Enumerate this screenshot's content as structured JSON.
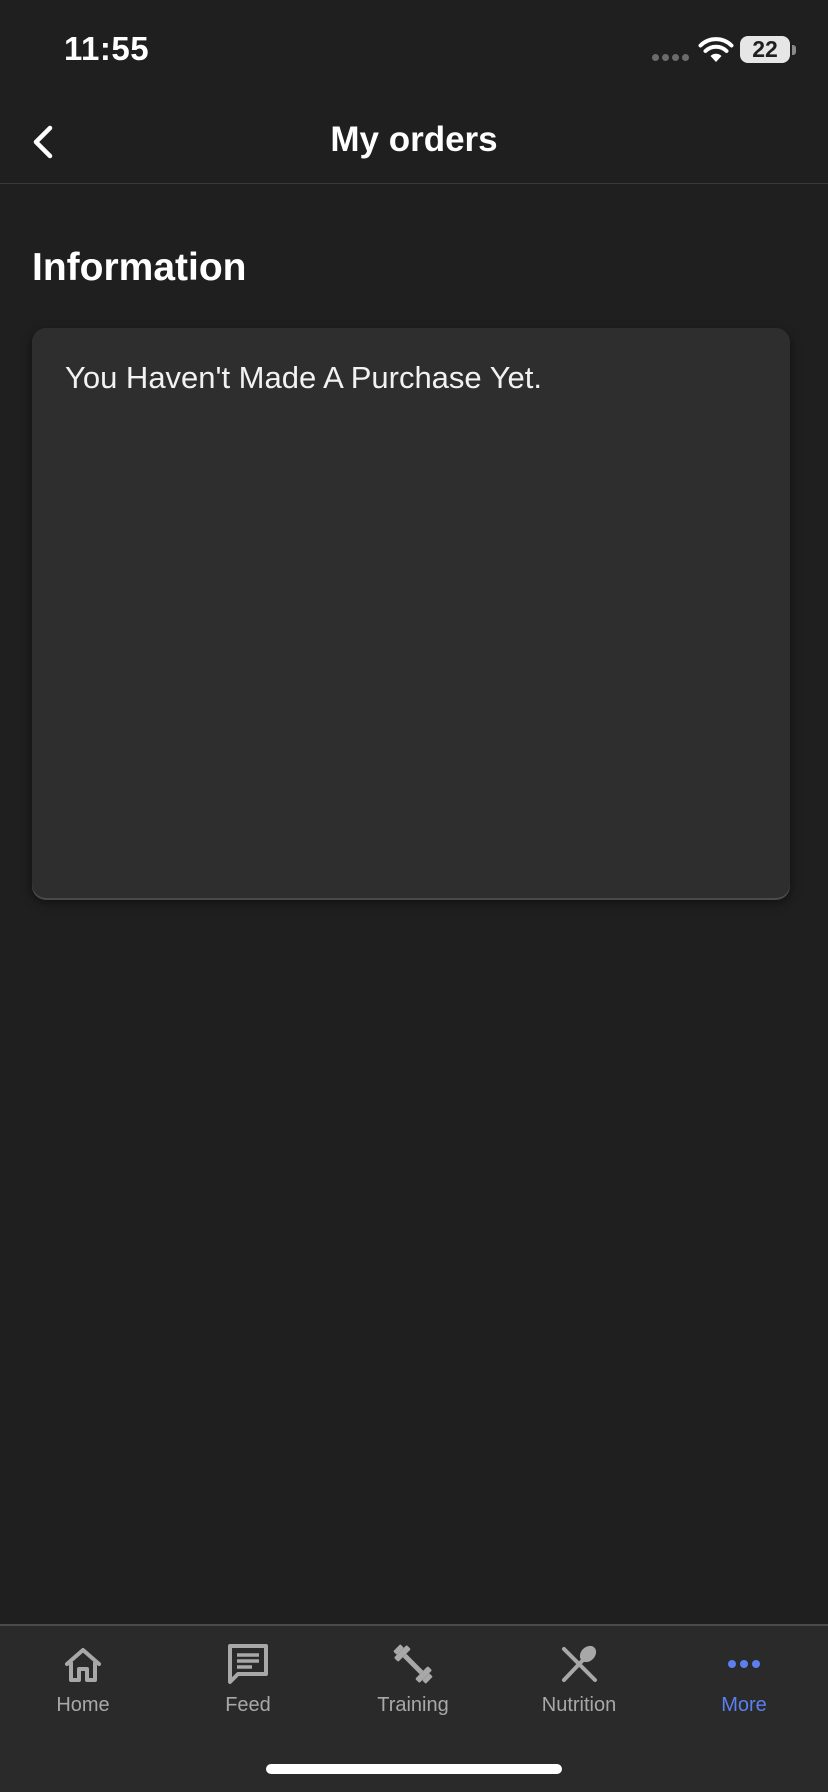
{
  "status_bar": {
    "time": "11:55",
    "battery": "22"
  },
  "nav": {
    "title": "My orders"
  },
  "content": {
    "heading": "Information",
    "message": "You Haven't Made A Purchase Yet."
  },
  "tab_bar": {
    "tabs": [
      {
        "label": "Home",
        "icon": "home-icon"
      },
      {
        "label": "Feed",
        "icon": "chat-icon"
      },
      {
        "label": "Training",
        "icon": "dumbbell-icon"
      },
      {
        "label": "Nutrition",
        "icon": "utensils-icon"
      },
      {
        "label": "More",
        "icon": "more-dots-icon"
      }
    ],
    "active_tab": "More"
  },
  "colors": {
    "background": "#1f1f1f",
    "card": "#2e2e2e",
    "tab_bar": "#2a2a2a",
    "accent": "#5b7ff0",
    "tab_inactive": "#a8a8a8"
  }
}
